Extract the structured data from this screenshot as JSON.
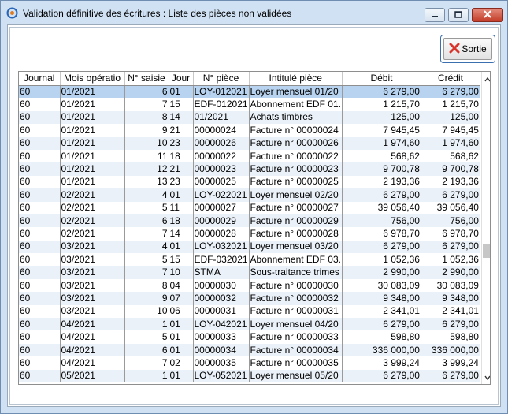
{
  "window": {
    "title": "Validation définitive des écritures : Liste des pièces non validées"
  },
  "toolbar": {
    "sortie_label": "Sortie"
  },
  "colors": {
    "accent": "#3a6fb0",
    "row_alt": "#eaf1f8",
    "row_selected": "#b8d3ef",
    "close_red": "#c33c28"
  },
  "icons": [
    "app-icon",
    "minimize-icon",
    "maximize-icon",
    "close-icon",
    "exit-x-icon",
    "scroll-up-icon",
    "scroll-down-icon"
  ],
  "table": {
    "columns": [
      "Journal",
      "Mois opératio",
      "N° saisie",
      "Jour",
      "N° pièce",
      "Intitulé pièce",
      "Débit",
      "Crédit"
    ],
    "rows": [
      [
        "60",
        "01/2021",
        "6",
        "01",
        "LOY-012021",
        "Loyer mensuel 01/20",
        "6 279,00",
        "6 279,00"
      ],
      [
        "60",
        "01/2021",
        "7",
        "15",
        "EDF-012021",
        "Abonnement EDF 01.",
        "1 215,70",
        "1 215,70"
      ],
      [
        "60",
        "01/2021",
        "8",
        "14",
        "01/2021",
        "Achats timbres",
        "125,00",
        "125,00"
      ],
      [
        "60",
        "01/2021",
        "9",
        "21",
        "00000024",
        "Facture n° 00000024",
        "7 945,45",
        "7 945,45"
      ],
      [
        "60",
        "01/2021",
        "10",
        "23",
        "00000026",
        "Facture n° 00000026",
        "1 974,60",
        "1 974,60"
      ],
      [
        "60",
        "01/2021",
        "11",
        "18",
        "00000022",
        "Facture n° 00000022",
        "568,62",
        "568,62"
      ],
      [
        "60",
        "01/2021",
        "12",
        "21",
        "00000023",
        "Facture n° 00000023",
        "9 700,78",
        "9 700,78"
      ],
      [
        "60",
        "01/2021",
        "13",
        "23",
        "00000025",
        "Facture n° 00000025",
        "2 193,36",
        "2 193,36"
      ],
      [
        "60",
        "02/2021",
        "4",
        "01",
        "LOY-022021",
        "Loyer mensuel 02/20",
        "6 279,00",
        "6 279,00"
      ],
      [
        "60",
        "02/2021",
        "5",
        "11",
        "00000027",
        "Facture n° 00000027",
        "39 056,40",
        "39 056,40"
      ],
      [
        "60",
        "02/2021",
        "6",
        "18",
        "00000029",
        "Facture n° 00000029",
        "756,00",
        "756,00"
      ],
      [
        "60",
        "02/2021",
        "7",
        "14",
        "00000028",
        "Facture n° 00000028",
        "6 978,70",
        "6 978,70"
      ],
      [
        "60",
        "03/2021",
        "4",
        "01",
        "LOY-032021",
        "Loyer mensuel 03/20",
        "6 279,00",
        "6 279,00"
      ],
      [
        "60",
        "03/2021",
        "5",
        "15",
        "EDF-032021",
        "Abonnement EDF 03.",
        "1 052,36",
        "1 052,36"
      ],
      [
        "60",
        "03/2021",
        "7",
        "10",
        "STMA",
        "Sous-traitance trimes",
        "2 990,00",
        "2 990,00"
      ],
      [
        "60",
        "03/2021",
        "8",
        "04",
        "00000030",
        "Facture n° 00000030",
        "30 083,09",
        "30 083,09"
      ],
      [
        "60",
        "03/2021",
        "9",
        "07",
        "00000032",
        "Facture n° 00000032",
        "9 348,00",
        "9 348,00"
      ],
      [
        "60",
        "03/2021",
        "10",
        "06",
        "00000031",
        "Facture n° 00000031",
        "2 341,01",
        "2 341,01"
      ],
      [
        "60",
        "04/2021",
        "1",
        "01",
        "LOY-042021",
        "Loyer mensuel 04/20",
        "6 279,00",
        "6 279,00"
      ],
      [
        "60",
        "04/2021",
        "5",
        "01",
        "00000033",
        "Facture n° 00000033",
        "598,80",
        "598,80"
      ],
      [
        "60",
        "04/2021",
        "6",
        "01",
        "00000034",
        "Facture n° 00000034",
        "336 000,00",
        "336 000,00"
      ],
      [
        "60",
        "04/2021",
        "7",
        "02",
        "00000035",
        "Facture n° 00000035",
        "3 999,24",
        "3 999,24"
      ],
      [
        "60",
        "05/2021",
        "1",
        "01",
        "LOY-052021",
        "Loyer mensuel 05/20",
        "6 279,00",
        "6 279,00"
      ]
    ]
  }
}
